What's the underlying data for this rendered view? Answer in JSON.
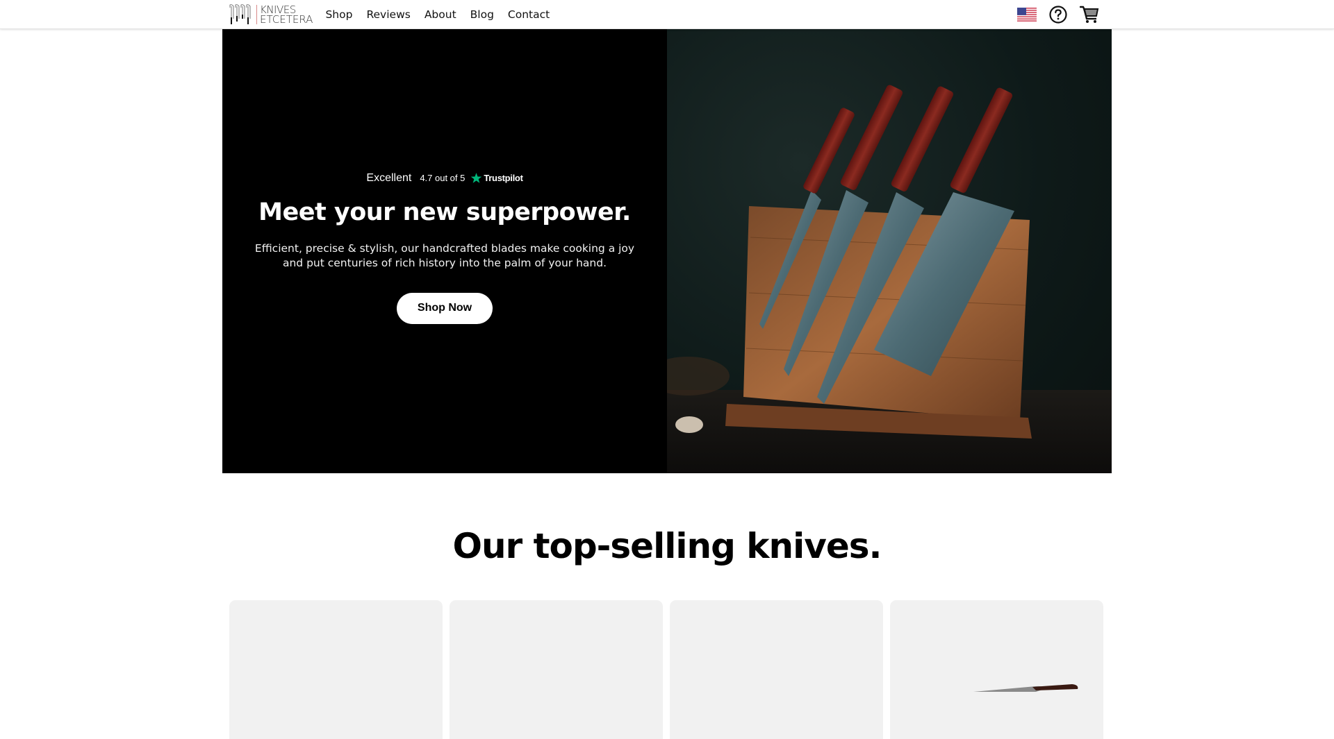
{
  "header": {
    "logo": {
      "line1": "KNIVES",
      "line2": "ETCETERA"
    },
    "nav": [
      {
        "label": "Shop"
      },
      {
        "label": "Reviews"
      },
      {
        "label": "About"
      },
      {
        "label": "Blog"
      },
      {
        "label": "Contact"
      }
    ],
    "icons": {
      "flag": "us-flag-icon",
      "help": "help-circle-icon",
      "cart": "shopping-cart-icon"
    }
  },
  "hero": {
    "rating": {
      "label": "Excellent",
      "score_text": "4.7 out of 5",
      "brand": "Trustpilot",
      "star_color": "#00b67a"
    },
    "title": "Meet your new superpower.",
    "description": "Efficient, precise & stylish, our handcrafted blades make cooking a joy and put centuries of rich history into the palm of your hand.",
    "cta_label": "Shop Now",
    "image_alt": "Four Damascus steel knives with red wood handles on a magnetic wooden stand"
  },
  "products": {
    "title": "Our top-selling knives.",
    "cards": [
      {
        "name": "product-card-1"
      },
      {
        "name": "product-card-2"
      },
      {
        "name": "product-card-3"
      },
      {
        "name": "product-card-4"
      }
    ]
  }
}
